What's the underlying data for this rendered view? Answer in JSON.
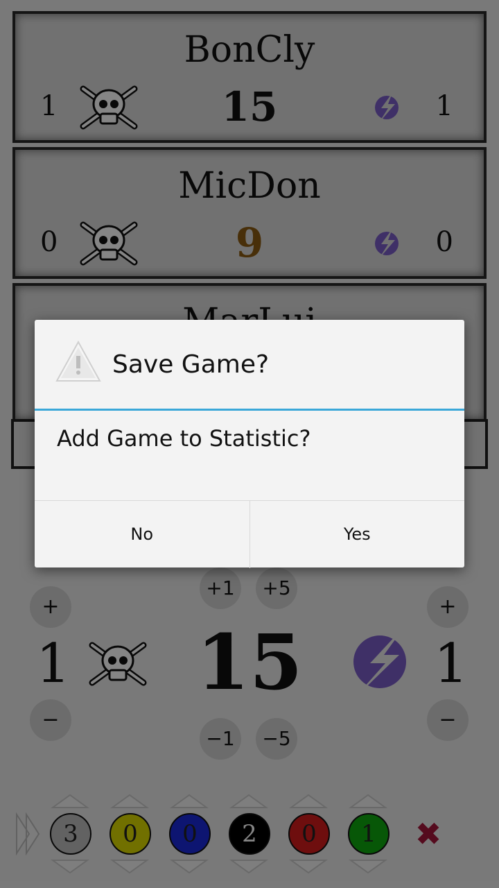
{
  "players": [
    {
      "name": "BonCly",
      "left_count": "1",
      "life": "15",
      "right_count": "1",
      "life_color": "#111111"
    },
    {
      "name": "MicDon",
      "left_count": "0",
      "life": "9",
      "right_count": "0",
      "life_color": "#8a5a12"
    },
    {
      "name": "MarLui"
    }
  ],
  "controls": {
    "plus": "+",
    "minus": "−",
    "plus1": "+1",
    "plus5": "+5",
    "minus1": "−1",
    "minus5": "−5",
    "left_count": "1",
    "life": "15",
    "right_count": "1"
  },
  "mana": [
    {
      "value": "3",
      "color": "#bcbcbc"
    },
    {
      "value": "0",
      "color": "#d8d600"
    },
    {
      "value": "0",
      "color": "#1a2ad8"
    },
    {
      "value": "2",
      "color": "#000000"
    },
    {
      "value": "0",
      "color": "#d41c1c"
    },
    {
      "value": "1",
      "color": "#0fa70f"
    }
  ],
  "close_glyph": "✖",
  "dialog": {
    "title": "Save Game?",
    "message": "Add Game to Statistic?",
    "no_label": "No",
    "yes_label": "Yes",
    "accent": "#3aa7d8"
  }
}
